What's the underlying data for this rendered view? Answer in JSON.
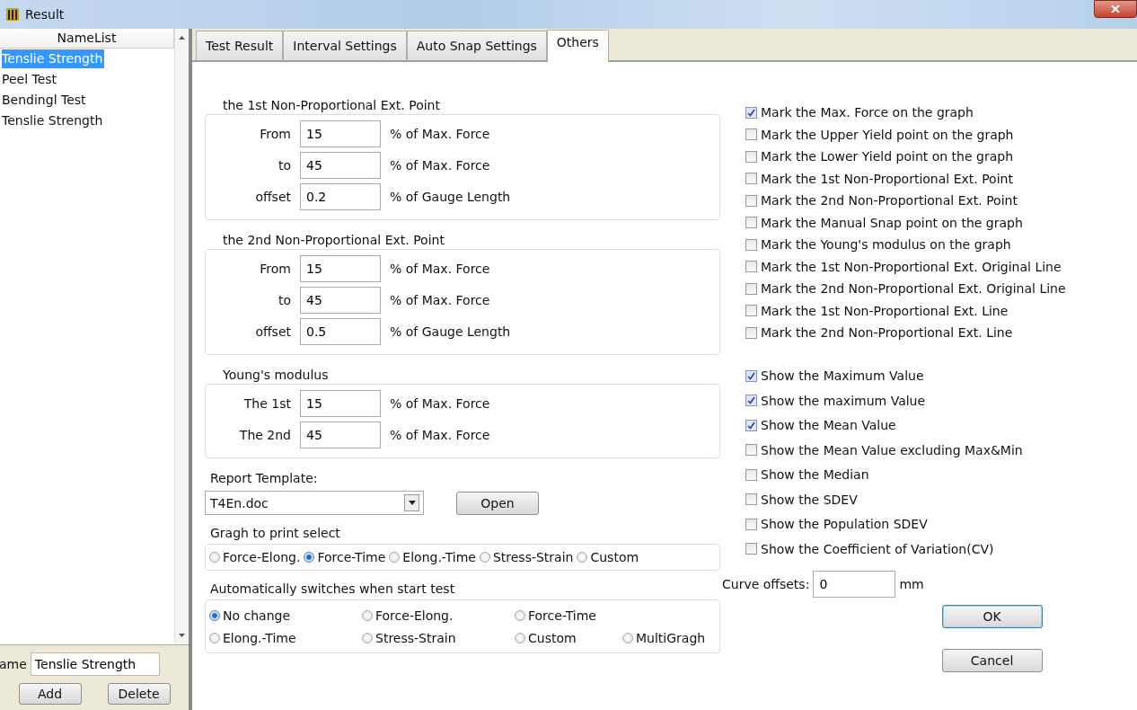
{
  "window": {
    "title": "Result"
  },
  "name_list": {
    "header": "NameList",
    "items": [
      {
        "label": "Tenslie Strength",
        "selected": true
      },
      {
        "label": "Peel Test",
        "selected": false
      },
      {
        "label": "Bendingl Test",
        "selected": false
      },
      {
        "label": "Tenslie Strength",
        "selected": false
      }
    ],
    "name_label": "ame",
    "name_value": "Tenslie Strength",
    "buttons": [
      "Add",
      "Delete"
    ]
  },
  "tabs": [
    {
      "label": "Test Result",
      "selected": false
    },
    {
      "label": "Interval Settings",
      "selected": false
    },
    {
      "label": "Auto Snap Settings",
      "selected": false
    },
    {
      "label": "Others",
      "selected": true
    }
  ],
  "groups": [
    {
      "title": "the 1st Non-Proportional Ext. Point",
      "rows": [
        {
          "label": "From",
          "value": "15",
          "unit": "% of Max. Force"
        },
        {
          "label": "to",
          "value": "45",
          "unit": "% of Max. Force"
        },
        {
          "label": "offset",
          "value": "0.2",
          "unit": "% of Gauge Length"
        }
      ]
    },
    {
      "title": "the 2nd Non-Proportional Ext. Point",
      "rows": [
        {
          "label": "From",
          "value": "15",
          "unit": "% of Max. Force"
        },
        {
          "label": "to",
          "value": "45",
          "unit": "% of Max. Force"
        },
        {
          "label": "offset",
          "value": "0.5",
          "unit": "% of Gauge Length"
        }
      ]
    },
    {
      "title": "Young's modulus",
      "rows": [
        {
          "label": "The 1st",
          "value": "15",
          "unit": "% of Max. Force"
        },
        {
          "label": "The 2nd",
          "value": "45",
          "unit": "% of Max. Force"
        }
      ]
    }
  ],
  "report_template": {
    "label": "Report Template:",
    "value": "T4En.doc",
    "button": "Open"
  },
  "graph_print": {
    "label": "Gragh to print select",
    "options": [
      {
        "label": "Force-Elong.",
        "selected": false
      },
      {
        "label": "Force-Time",
        "selected": true
      },
      {
        "label": "Elong.-Time",
        "selected": false
      },
      {
        "label": "Stress-Strain",
        "selected": false
      },
      {
        "label": "Custom",
        "selected": false
      }
    ]
  },
  "auto_switch": {
    "label": "Automatically switches when start test",
    "rows": [
      [
        {
          "label": "No change",
          "selected": true
        },
        {
          "label": "Force-Elong.",
          "selected": false
        },
        {
          "label": "Force-Time",
          "selected": false
        }
      ],
      [
        {
          "label": "Elong.-Time",
          "selected": false
        },
        {
          "label": "Stress-Strain",
          "selected": false
        },
        {
          "label": "Custom",
          "selected": false
        },
        {
          "label": "MultiGragh",
          "selected": false
        }
      ]
    ]
  },
  "mark_options": [
    {
      "label": "Mark the Max. Force on the graph",
      "checked": true
    },
    {
      "label": "Mark the Upper Yield point on the graph",
      "checked": false
    },
    {
      "label": "Mark the Lower Yield point on the graph",
      "checked": false
    },
    {
      "label": "Mark the 1st Non-Proportional Ext. Point",
      "checked": false
    },
    {
      "label": "Mark the 2nd Non-Proportional Ext. Point",
      "checked": false
    },
    {
      "label": "Mark the Manual Snap point on the graph",
      "checked": false
    },
    {
      "label": "Mark the Young's modulus on the graph",
      "checked": false
    },
    {
      "label": "Mark the 1st Non-Proportional Ext. Original Line",
      "checked": false
    },
    {
      "label": "Mark the 2nd Non-Proportional Ext. Original Line",
      "checked": false
    },
    {
      "label": "Mark the 1st Non-Proportional Ext. Line",
      "checked": false
    },
    {
      "label": "Mark the 2nd Non-Proportional Ext. Line",
      "checked": false
    }
  ],
  "show_options": [
    {
      "label": "Show the Maximum Value",
      "checked": true
    },
    {
      "label": "Show the maximum Value",
      "checked": true
    },
    {
      "label": "Show the Mean Value",
      "checked": true
    },
    {
      "label": "Show the Mean Value excluding Max&Min",
      "checked": false
    },
    {
      "label": "Show the Median",
      "checked": false
    },
    {
      "label": "Show the SDEV",
      "checked": false
    },
    {
      "label": "Show the Population SDEV",
      "checked": false
    },
    {
      "label": "Show the Coefficient of Variation(CV)",
      "checked": false
    }
  ],
  "curve_offsets": {
    "label": "Curve offsets:",
    "value": "0",
    "unit": "mm"
  },
  "dialog_buttons": [
    "OK",
    "Cancel"
  ]
}
